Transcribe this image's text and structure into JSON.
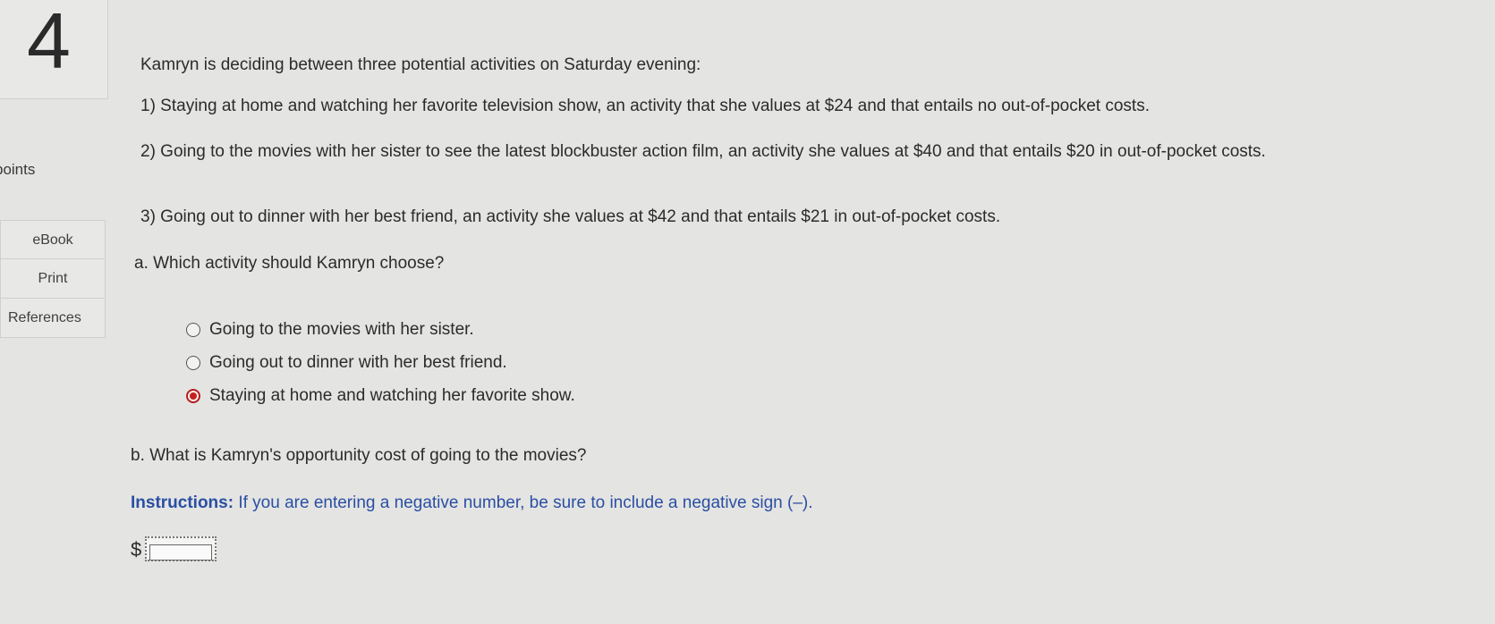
{
  "sidebar": {
    "question_number": "4",
    "points_label": "points",
    "links": {
      "ebook": "eBook",
      "print": "Print",
      "references": "References"
    }
  },
  "question": {
    "intro": "Kamryn is deciding between three potential activities on Saturday evening:",
    "activities": [
      "1) Staying at home and watching her favorite television show, an activity that she values at $24 and that entails no out-of-pocket costs.",
      "2) Going to the movies with her sister to see the latest blockbuster action film, an activity she values at $40 and that entails $20 in out-of-pocket costs.",
      "3) Going out to dinner with her best friend, an activity she values at $42 and that entails $21 in out-of-pocket costs."
    ],
    "part_a": {
      "prompt": "a. Which activity should Kamryn choose?",
      "options": [
        {
          "label": "Going to the movies with her sister.",
          "selected": false
        },
        {
          "label": "Going out to dinner with her best friend.",
          "selected": false
        },
        {
          "label": "Staying at home and watching her favorite show.",
          "selected": true
        }
      ]
    },
    "part_b": {
      "prompt": "b. What is Kamryn's opportunity cost of going to the movies?",
      "instructions_label": "Instructions:",
      "instructions_text": " If you are entering a negative number, be sure to include a negative sign (–).",
      "currency_symbol": "$",
      "answer_value": ""
    }
  },
  "colors": {
    "background": "#e4e4e2",
    "selected_radio": "#c8201f",
    "instructions": "#2a4fa3"
  }
}
